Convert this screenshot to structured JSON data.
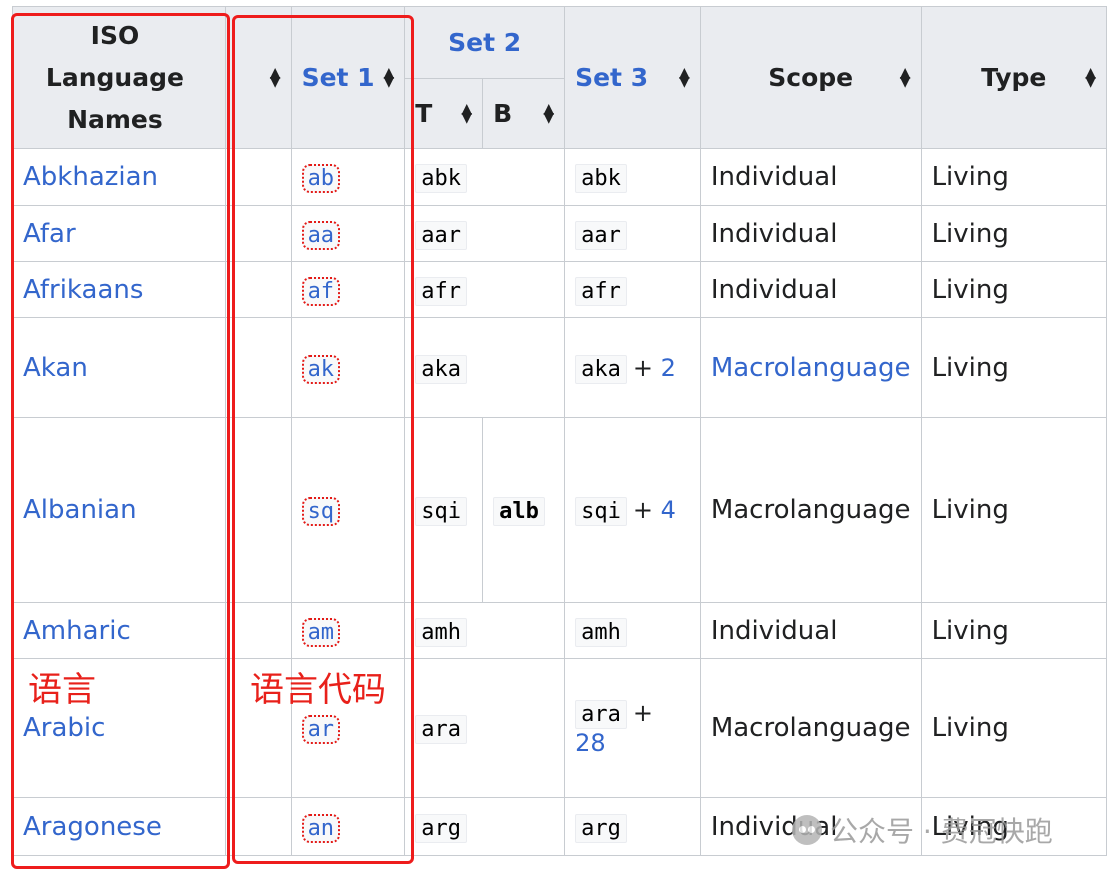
{
  "header": {
    "names": "ISO Language Names",
    "set1": "Set 1",
    "set2": "Set 2",
    "set3": "Set 3",
    "scope": "Scope",
    "type": "Type",
    "t": "T",
    "b": "B"
  },
  "rows": [
    {
      "name": "Abkhazian",
      "set1": "ab",
      "t": "abk",
      "b": "",
      "set3": "abk",
      "plus": "",
      "scope": "Individual",
      "scope_link": false,
      "type": "Living"
    },
    {
      "name": "Afar",
      "set1": "aa",
      "t": "aar",
      "b": "",
      "set3": "aar",
      "plus": "",
      "scope": "Individual",
      "scope_link": false,
      "type": "Living"
    },
    {
      "name": "Afrikaans",
      "set1": "af",
      "t": "afr",
      "b": "",
      "set3": "afr",
      "plus": "",
      "scope": "Individual",
      "scope_link": false,
      "type": "Living"
    },
    {
      "name": "Akan",
      "set1": "ak",
      "t": "aka",
      "b": "",
      "set3": "aka",
      "plus": "2",
      "scope": "Macrolanguage",
      "scope_link": true,
      "type": "Living"
    },
    {
      "name": "Albanian",
      "set1": "sq",
      "t": "sqi",
      "b": "alb",
      "set3": "sqi",
      "plus": "4",
      "scope": "Macrolanguage",
      "scope_link": false,
      "type": "Living"
    },
    {
      "name": "Amharic",
      "set1": "am",
      "t": "amh",
      "b": "",
      "set3": "amh",
      "plus": "",
      "scope": "Individual",
      "scope_link": false,
      "type": "Living"
    },
    {
      "name": "Arabic",
      "set1": "ar",
      "t": "ara",
      "b": "",
      "set3": "ara",
      "plus": "28",
      "scope": "Macrolanguage",
      "scope_link": false,
      "type": "Living"
    },
    {
      "name": "Aragonese",
      "set1": "an",
      "t": "arg",
      "b": "",
      "set3": "arg",
      "plus": "",
      "scope": "Individual",
      "scope_link": false,
      "type": "Living"
    }
  ],
  "annotations": {
    "language_label": "语言",
    "code_label": "语言代码"
  },
  "watermark": "公众号 · 费冠快跑",
  "colors": {
    "link": "#3366cc",
    "highlight": "#ee1c1c",
    "header_bg": "#eaecf0"
  }
}
